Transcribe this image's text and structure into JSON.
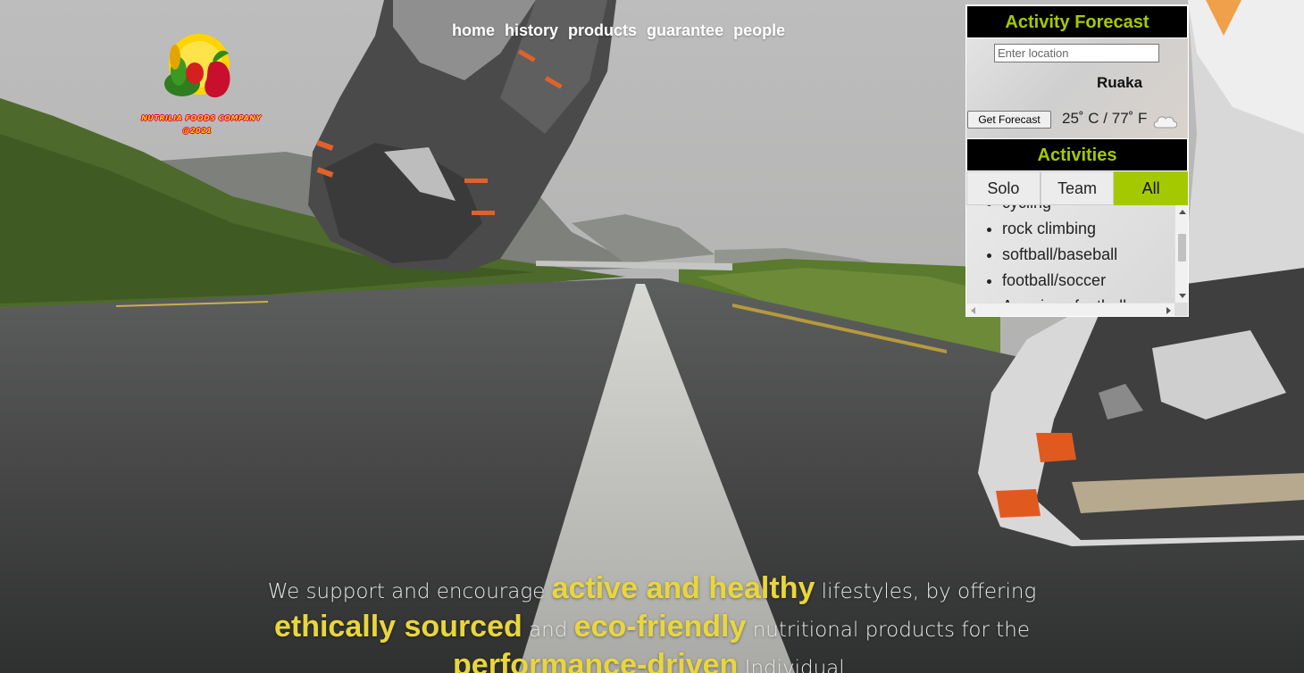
{
  "nav": {
    "items": [
      "home",
      "history",
      "products",
      "guarantee",
      "people"
    ]
  },
  "logo": {
    "line1": "NUTRILIA FOODS COMPANY",
    "line2": "@2021"
  },
  "forecast": {
    "title": "Activity Forecast",
    "input_placeholder": "Enter location",
    "city": "Ruaka",
    "button_label": "Get Forecast",
    "temperature": "25˚ C / 77˚ F",
    "weather_icon": "cloud-icon"
  },
  "activities": {
    "title": "Activities",
    "tabs": [
      "Solo",
      "Team",
      "All"
    ],
    "active_tab": "All",
    "items": [
      "cycling",
      "rock climbing",
      "softball/baseball",
      "football/soccer",
      "American football"
    ]
  },
  "tagline": {
    "part1": "We support and encourage ",
    "hl1": "active and healthy",
    "part2": " lifestyles, by offering ",
    "hl2": "ethically sourced",
    "part3": " and ",
    "hl3": "eco-friendly",
    "part4": " nutritional products for the ",
    "hl4": "performance-driven",
    "part5": " Individual."
  },
  "colors": {
    "accent": "#a5c900",
    "highlight": "#e9d63c"
  }
}
